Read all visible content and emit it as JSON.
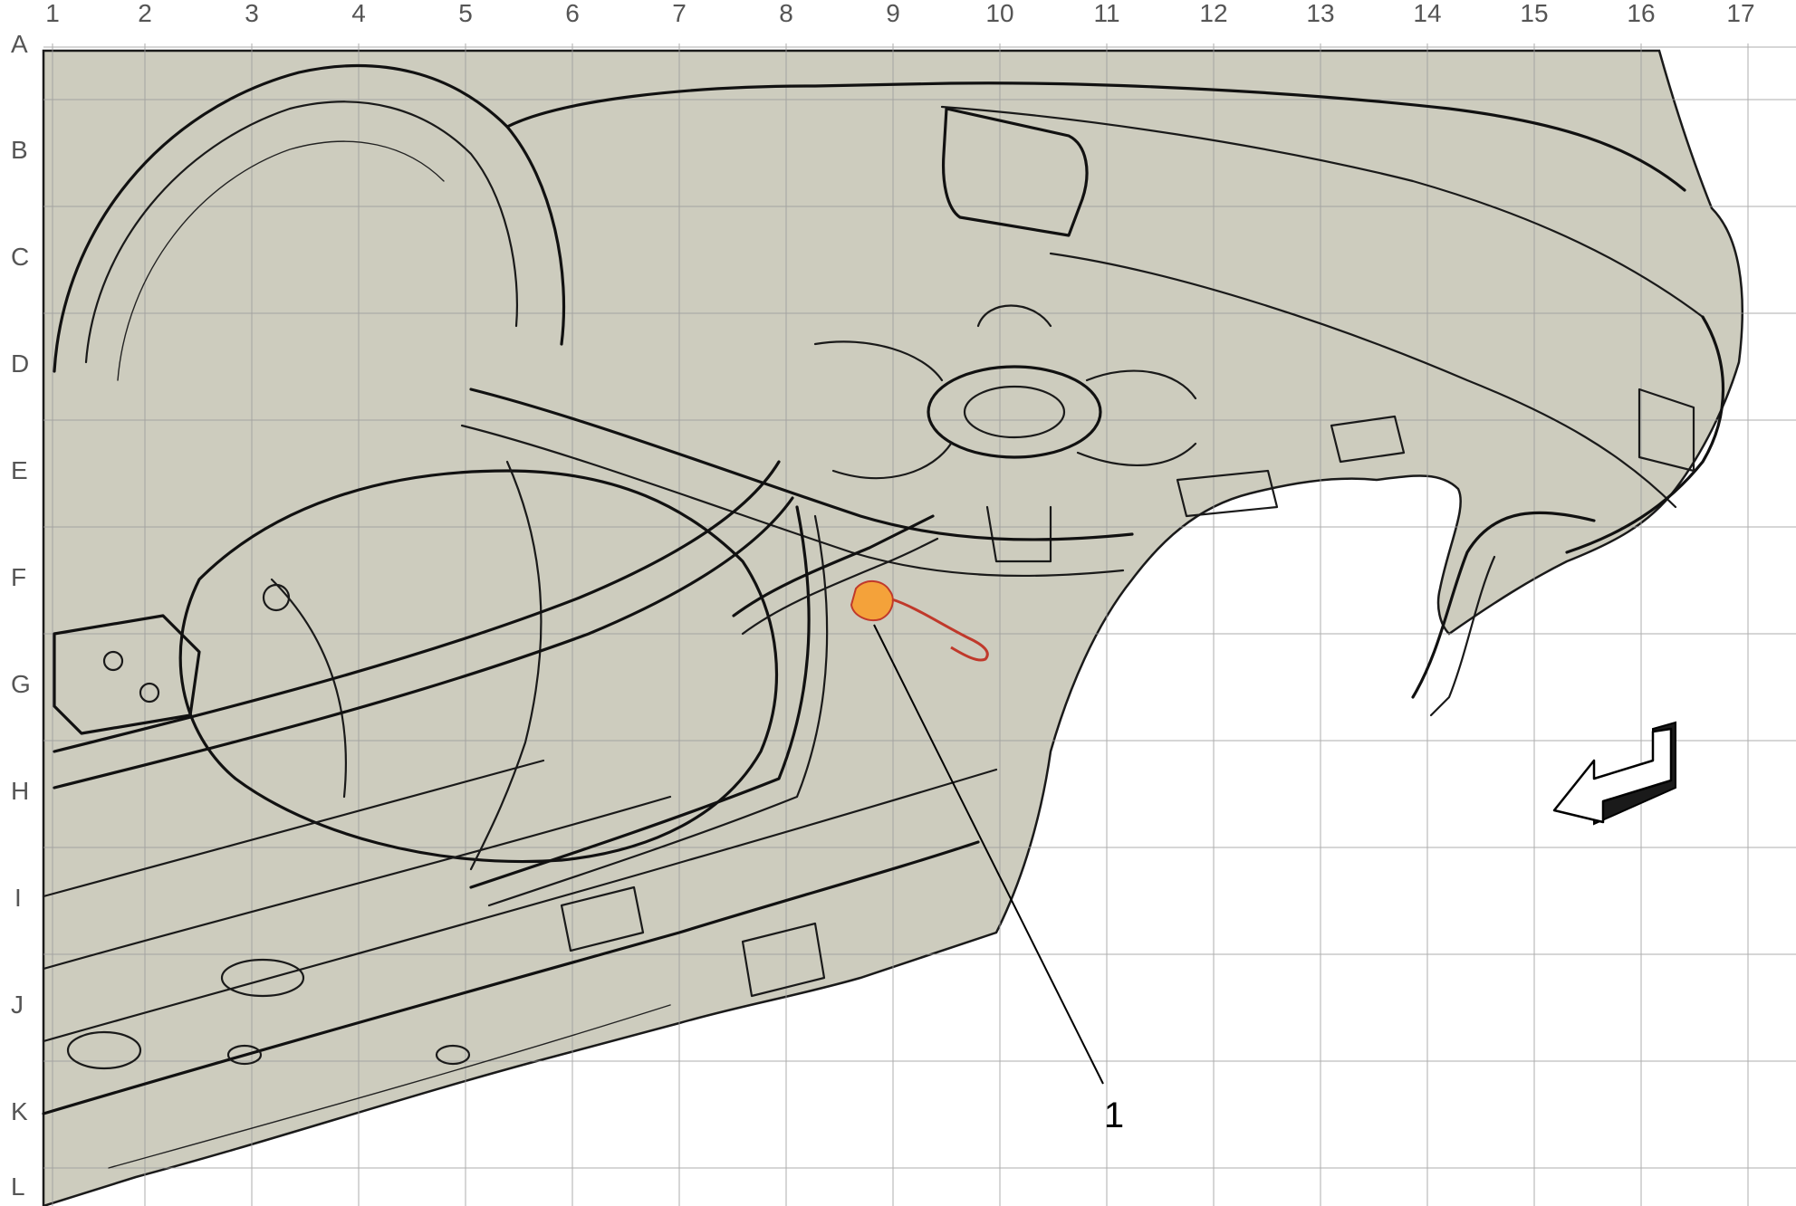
{
  "grid": {
    "columns": [
      "1",
      "2",
      "3",
      "4",
      "5",
      "6",
      "7",
      "8",
      "9",
      "10",
      "11",
      "12",
      "13",
      "14",
      "15",
      "16",
      "17"
    ],
    "rows": [
      "A",
      "B",
      "C",
      "D",
      "E",
      "F",
      "G",
      "H",
      "I",
      "J",
      "K",
      "L"
    ]
  },
  "callouts": [
    {
      "label": "1"
    }
  ],
  "colors": {
    "body_fill": "#cdccbe",
    "grid_line": "#9a9a9a",
    "highlight": "#f4a23a",
    "highlight_outline": "#c0392b",
    "background": "#ffffff"
  },
  "icons": {
    "direction_arrow": "front-direction-arrow-icon"
  }
}
